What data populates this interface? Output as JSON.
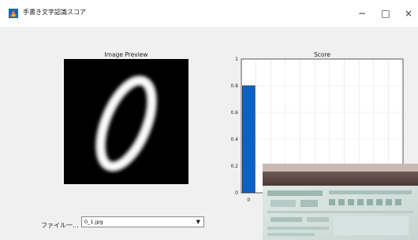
{
  "window": {
    "title": "手書き文字認識スコア",
    "minimize_glyph": "−",
    "maximize_glyph": "□",
    "close_glyph": "×",
    "accent_color": "#0b62c6"
  },
  "preview": {
    "title": "Image Preview"
  },
  "score_panel": {
    "title": "Score"
  },
  "file_selector": {
    "label": "ファイル一...",
    "value": "0_1.jpg",
    "dropdown_glyph": "▼"
  },
  "chart_data": {
    "type": "bar",
    "title": "Score",
    "categories": [
      "0"
    ],
    "values": [
      0.8
    ],
    "ylim": [
      0,
      1
    ],
    "yticks": [
      "0",
      "0.2",
      "0.4",
      "0.6",
      "0.8",
      "1"
    ],
    "xticks": [
      "0"
    ],
    "grid": true,
    "bar_color": "#0b62c6"
  }
}
